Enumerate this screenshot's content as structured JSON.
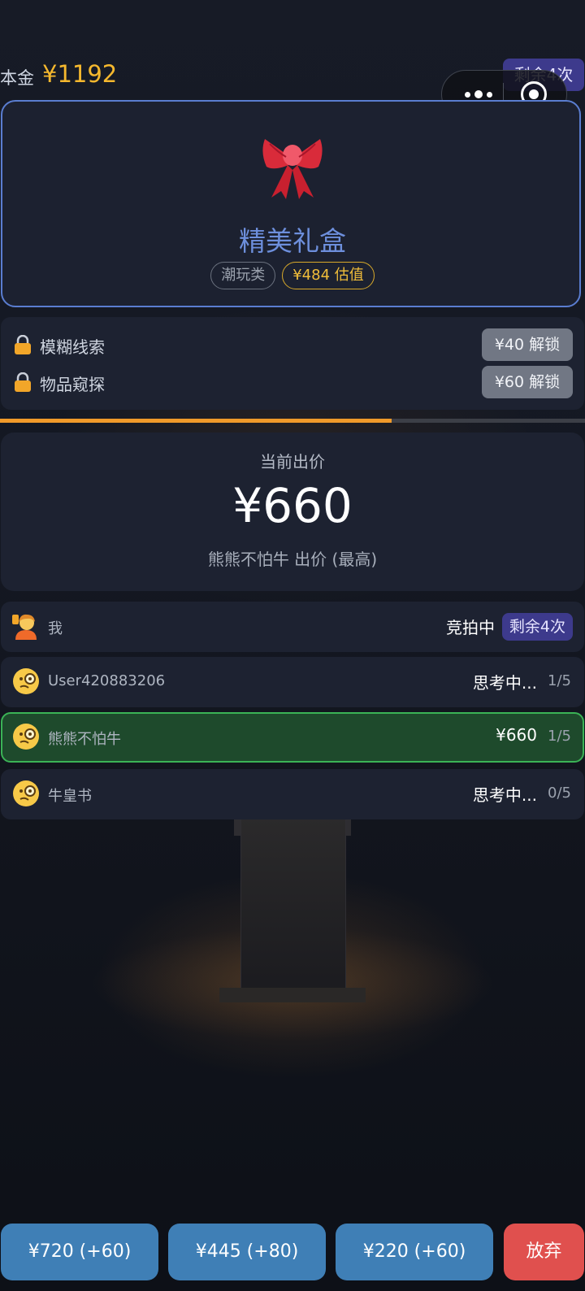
{
  "header": {
    "capital_label": "本金",
    "capital_value": "¥1192",
    "remaining": "剩余4次"
  },
  "mini_program_menu": {
    "more_icon": "more-dots-icon",
    "close_icon": "target-circle-icon"
  },
  "item": {
    "icon": "ribbon-bow-icon",
    "name": "精美礼盒",
    "category": "潮玩类",
    "estimate": "¥484 估值"
  },
  "clues": [
    {
      "icon": "lock-icon",
      "label": "模糊线索",
      "button": "¥40 解锁"
    },
    {
      "icon": "lock-icon",
      "label": "物品窥探",
      "button": "¥60 解锁"
    }
  ],
  "progress": {
    "fraction": 0.67
  },
  "current_bid": {
    "label": "当前出价",
    "value": "¥660",
    "bidder": "熊熊不怕牛 出价 (最高)"
  },
  "players": [
    {
      "name": "我",
      "status": "竞拍中",
      "chip": "剩余4次",
      "avatar": "user-avatar-icon"
    },
    {
      "name": "User420883206",
      "status": "思考中...",
      "count": "1/5",
      "avatar": "thinking-face-icon"
    },
    {
      "name": "熊熊不怕牛",
      "status": "¥660",
      "count": "1/5",
      "avatar": "thinking-face-icon"
    },
    {
      "name": "牛皇书",
      "status": "思考中...",
      "count": "0/5",
      "avatar": "thinking-face-icon"
    }
  ],
  "actions": [
    {
      "label": "¥720 (+60)"
    },
    {
      "label": "¥445 (+80)"
    },
    {
      "label": "¥220 (+60)"
    },
    {
      "label": "放弃"
    }
  ],
  "colors": {
    "accent_gold": "#f5b82e",
    "accent_blue": "#5a7dd0",
    "leader_green": "#3bb356",
    "button_blue": "#3f7fb6",
    "quit_red": "#e0504e",
    "chip_purple": "#3d3a8c"
  }
}
